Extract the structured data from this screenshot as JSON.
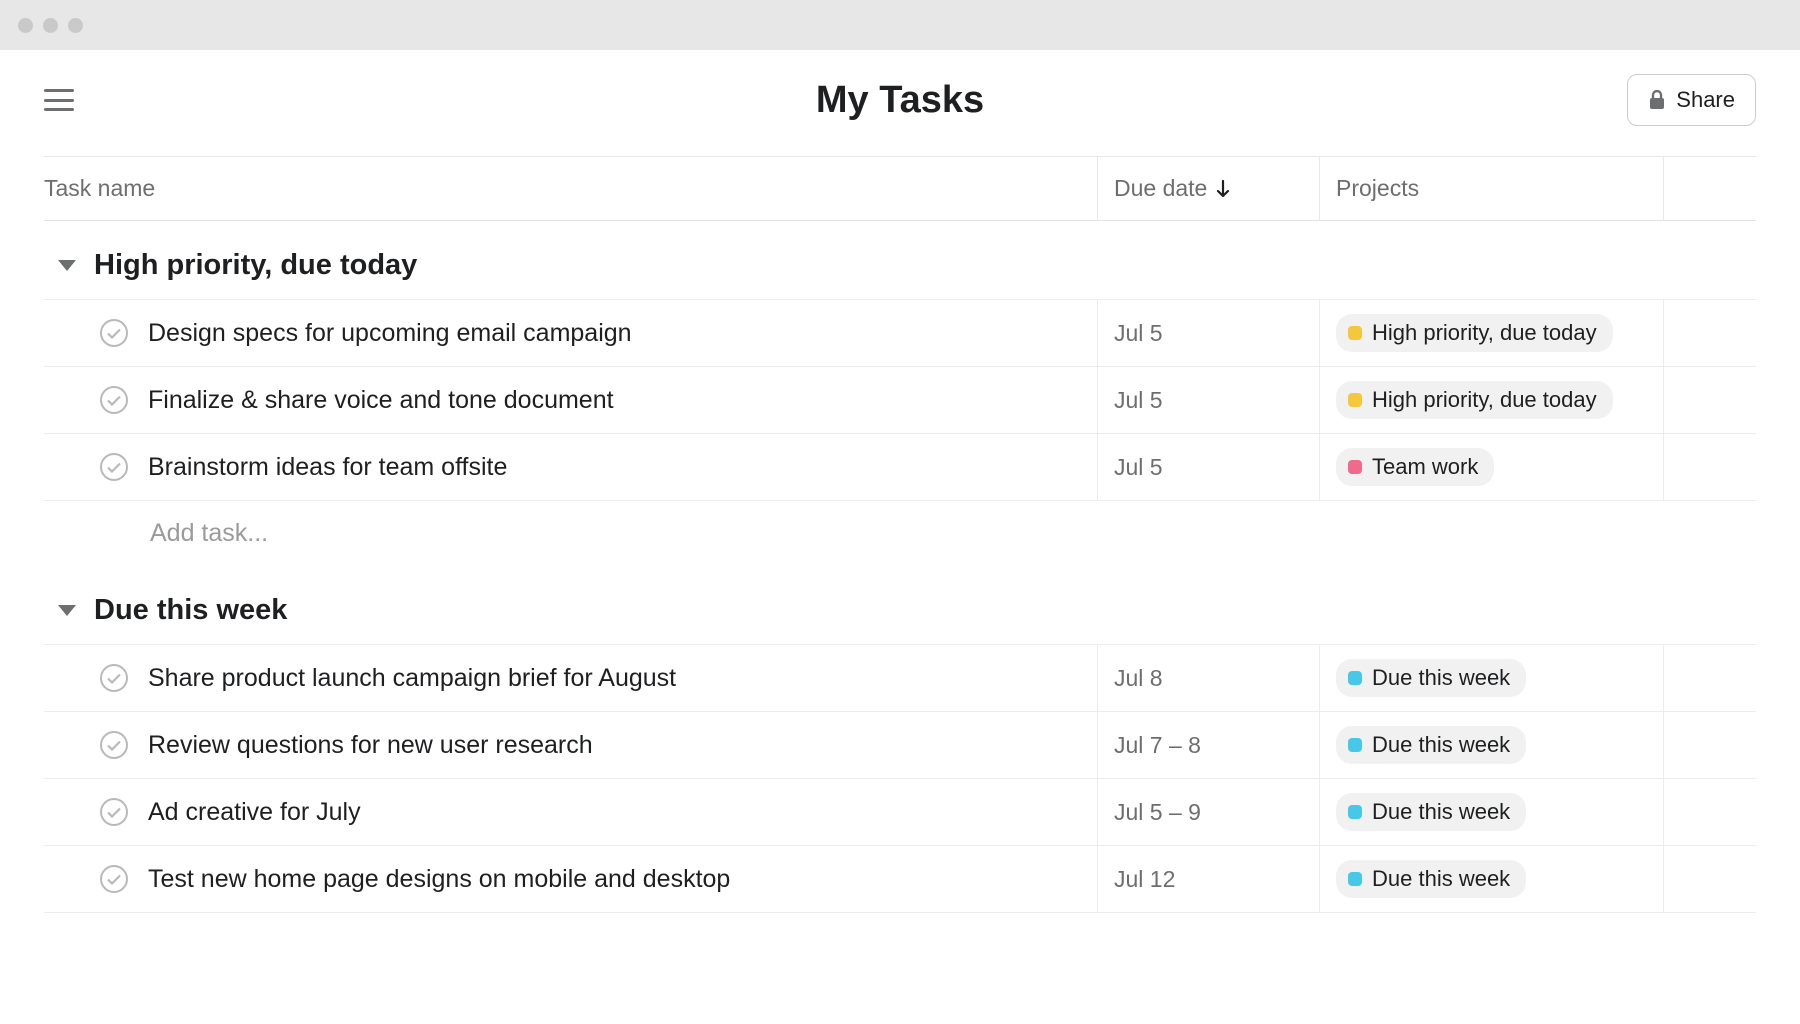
{
  "header": {
    "title": "My Tasks",
    "share_label": "Share"
  },
  "columns": {
    "name": "Task name",
    "due": "Due date",
    "projects": "Projects"
  },
  "add_task_placeholder": "Add task...",
  "tag_colors": {
    "High priority, due today": "yellow",
    "Team work": "pink",
    "Due this week": "cyan"
  },
  "sections": [
    {
      "title": "High priority, due today",
      "show_add": true,
      "tasks": [
        {
          "title": "Design specs for upcoming email campaign",
          "due": "Jul 5",
          "tag": "High priority, due today"
        },
        {
          "title": "Finalize & share voice and tone document",
          "due": "Jul 5",
          "tag": "High priority, due today"
        },
        {
          "title": "Brainstorm ideas for team offsite",
          "due": "Jul 5",
          "tag": "Team work"
        }
      ]
    },
    {
      "title": "Due this week",
      "show_add": false,
      "tasks": [
        {
          "title": "Share product launch campaign brief for August",
          "due": "Jul 8",
          "tag": "Due this week"
        },
        {
          "title": "Review questions for new user research",
          "due": "Jul 7 – 8",
          "tag": "Due this week"
        },
        {
          "title": "Ad creative for July",
          "due": "Jul 5 – 9",
          "tag": "Due this week"
        },
        {
          "title": "Test new home page designs on mobile and desktop",
          "due": "Jul 12",
          "tag": "Due this week"
        }
      ]
    }
  ]
}
